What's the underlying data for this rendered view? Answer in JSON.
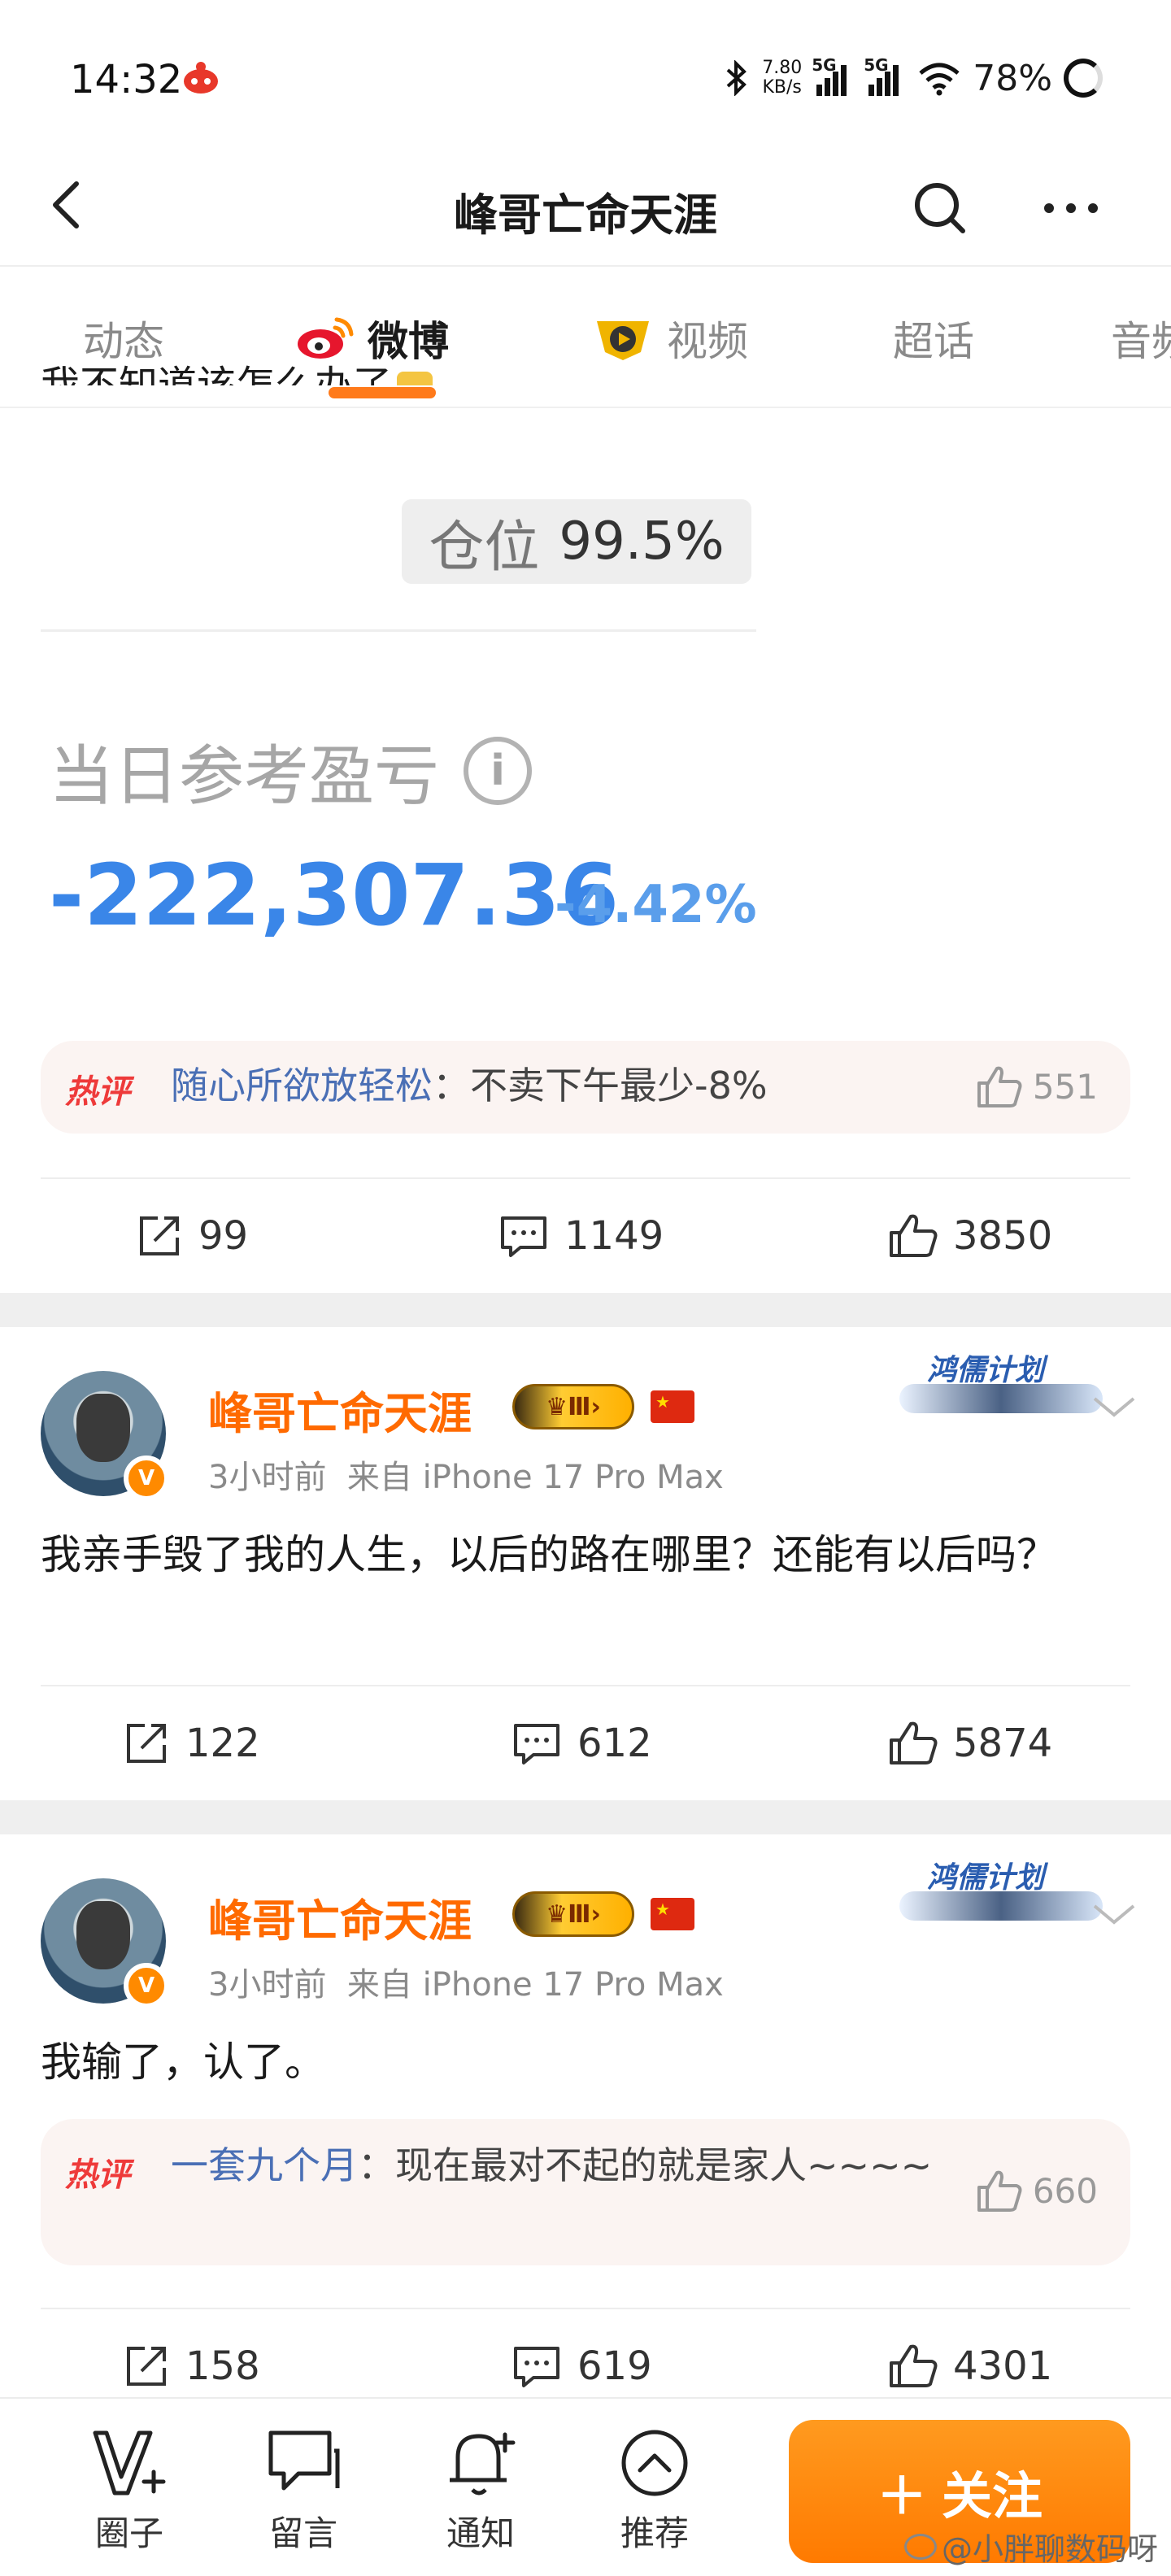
{
  "status_bar": {
    "time": "14:32",
    "net_speed_value": "7.80",
    "net_speed_unit": "KB/s",
    "signal1_label": "5G",
    "signal2_label": "5G",
    "battery": "78%"
  },
  "header": {
    "title": "峰哥亡命天涯"
  },
  "tabs": [
    {
      "label": "动态"
    },
    {
      "label": "微博"
    },
    {
      "label": "视频"
    },
    {
      "label": "超话"
    },
    {
      "label": "音频"
    }
  ],
  "post1": {
    "cut_text": "我不知道该怎么办了",
    "position_label": "仓位",
    "position_value": "99.5%",
    "pl_label": "当日参考盈亏",
    "pl_value": "-222,307.36",
    "pl_pct": "-4.42%",
    "hot_badge": "热评",
    "hot_user": "随心所欲放轻松",
    "hot_text": "：不卖下午最少-8%",
    "hot_likes": "551",
    "reposts": "99",
    "comments": "1149",
    "likes": "3850"
  },
  "post2": {
    "name": "峰哥亡命天涯",
    "level": "Ⅲ",
    "plan_badge": "鸿儒计划",
    "time": "3小时前",
    "source": "来自 iPhone 17 Pro Max",
    "text": "我亲手毁了我的人生，以后的路在哪里？还能有以后吗？",
    "reposts": "122",
    "comments": "612",
    "likes": "5874"
  },
  "post3": {
    "name": "峰哥亡命天涯",
    "level": "Ⅲ",
    "plan_badge": "鸿儒计划",
    "time": "3小时前",
    "source": "来自 iPhone 17 Pro Max",
    "text": "我输了，认了。",
    "hot_badge": "热评",
    "hot_user": "一套九个月",
    "hot_text": "：现在最对不起的就是家人~~~~",
    "hot_likes": "660",
    "reposts": "158",
    "comments": "619",
    "likes": "4301"
  },
  "bottom_bar": {
    "items": [
      {
        "label": "圈子"
      },
      {
        "label": "留言"
      },
      {
        "label": "通知"
      },
      {
        "label": "推荐"
      }
    ],
    "follow_label": "关注"
  },
  "watermark": "@小胖聊数码呀",
  "colors": {
    "accent": "#ff7a00",
    "name": "#ff6a00",
    "link": "#4a6fb5",
    "pl_blue": "#3a86e8",
    "hot_red": "#ee3a3a"
  }
}
